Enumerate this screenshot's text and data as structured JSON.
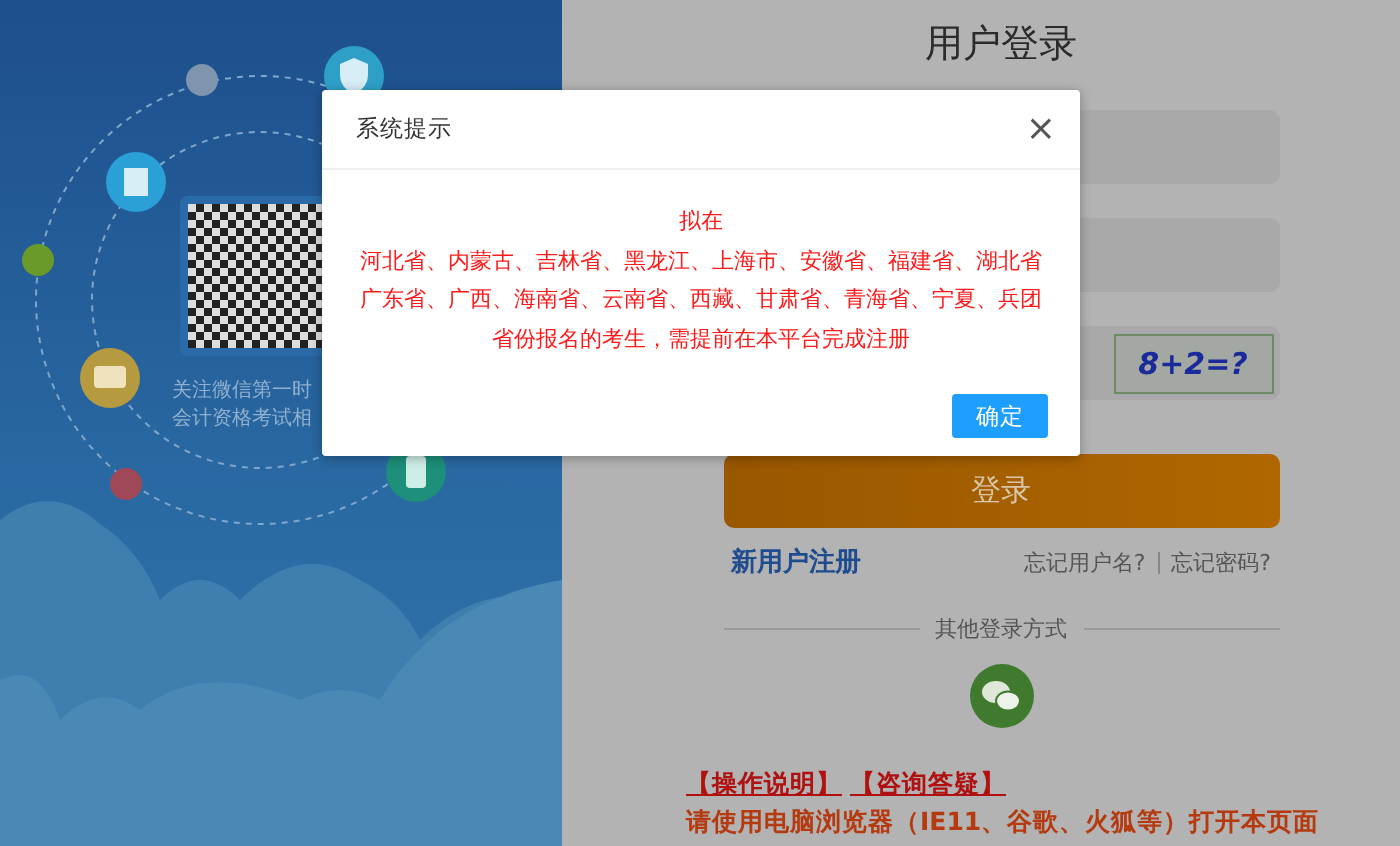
{
  "side_panel": {
    "qr_caption": [
      "关注微信第一时",
      "会计资格考试相"
    ]
  },
  "login": {
    "title": "用户登录",
    "captcha": "8+2=?",
    "login_button": "登录",
    "register_link": "新用户注册",
    "forgot_links": [
      "忘记用户名?",
      "忘记密码?"
    ],
    "other_login_label": "其他登录方式",
    "help_links": [
      "【操作说明】",
      "【咨询答疑】"
    ],
    "notice": "请使用电脑浏览器（IE11、谷歌、火狐等）打开本页面"
  },
  "dialog": {
    "title": "系统提示",
    "close": "×",
    "message_lines": [
      "拟在",
      "河北省、内蒙古、吉林省、黑龙江、上海市、安徽省、福建省、湖北省",
      "广东省、广西、海南省、云南省、西藏、甘肃省、青海省、宁夏、兵团",
      "省份报名的考生，需提前在本平台完成注册"
    ],
    "confirm_button": "确定"
  }
}
